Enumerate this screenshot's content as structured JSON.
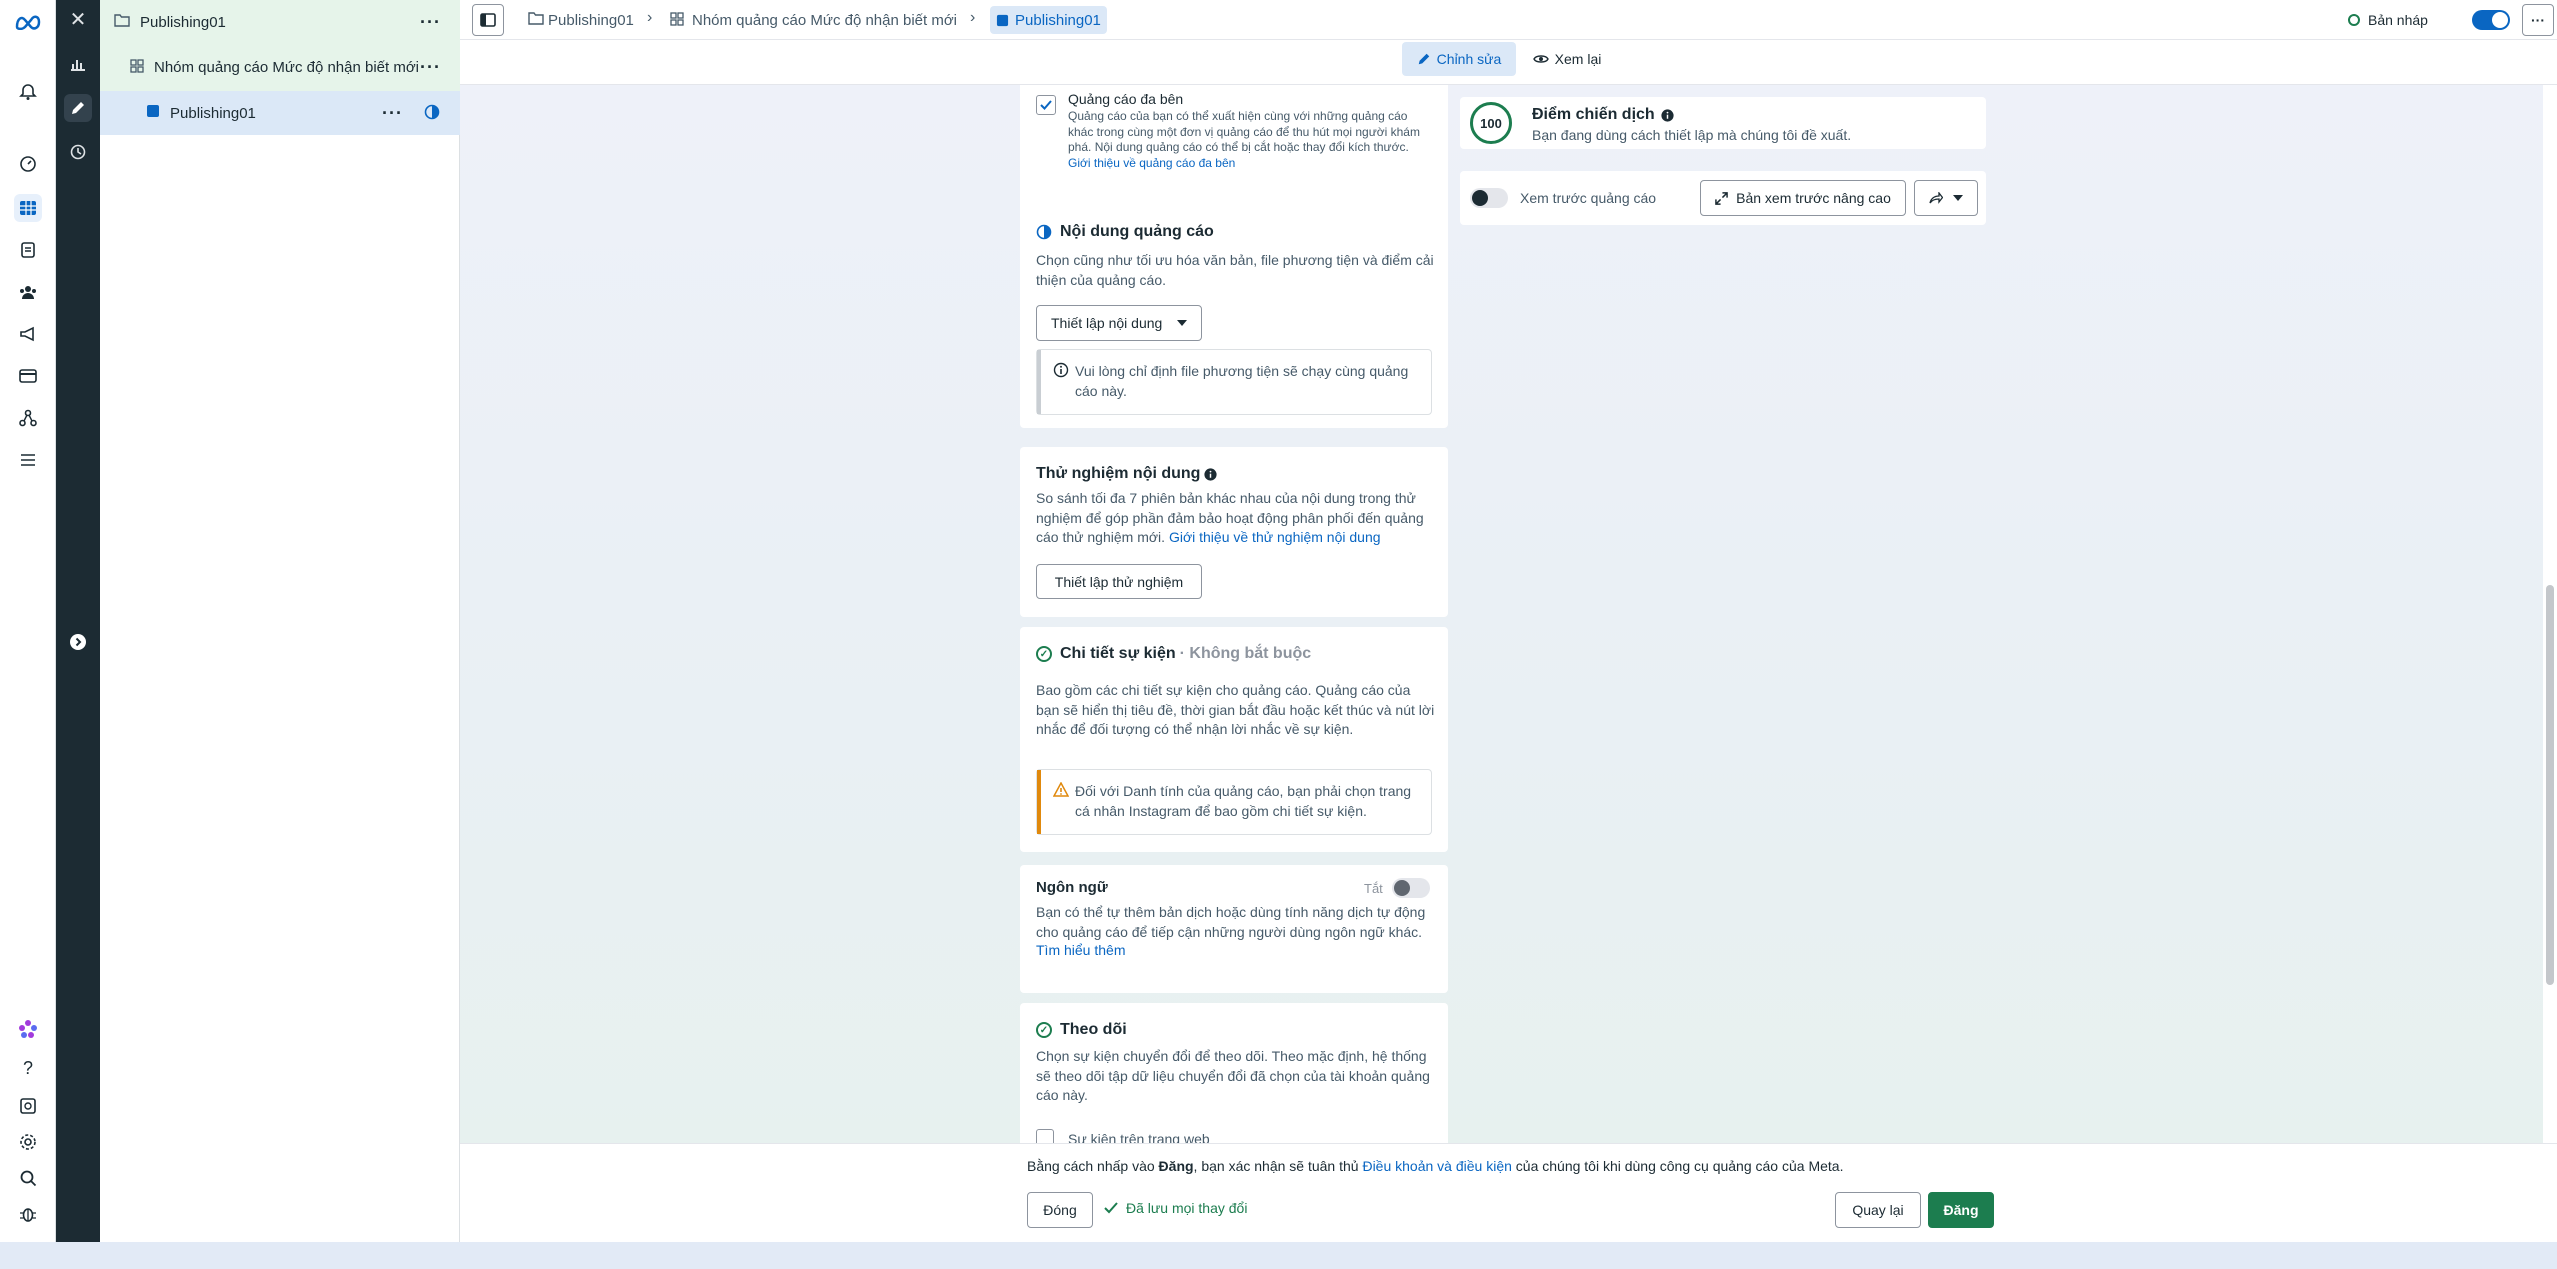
{
  "tree": {
    "campaign": "Publishing01",
    "adset": "Nhóm quảng cáo Mức độ nhận biết mới",
    "ad": "Publishing01"
  },
  "breadcrumb": {
    "campaign": "Publishing01",
    "adset": "Nhóm quảng cáo Mức độ nhận biết mới",
    "ad": "Publishing01"
  },
  "status": {
    "label": "Bản nháp"
  },
  "modes": {
    "edit": "Chỉnh sửa",
    "review": "Xem lại"
  },
  "multi_advertiser": {
    "title": "Quảng cáo đa bên",
    "desc": "Quảng cáo của bạn có thể xuất hiện cùng với những quảng cáo khác trong cùng một đơn vị quảng cáo để thu hút mọi người khám phá. Nội dung quảng cáo có thể bị cắt hoặc thay đổi kích thước.",
    "link": "Giới thiệu về quảng cáo đa bên"
  },
  "creative": {
    "title": "Nội dung quảng cáo",
    "desc": "Chọn cũng như tối ưu hóa văn bản, file phương tiện và điểm cải thiện của quảng cáo.",
    "dropdown": "Thiết lập nội dung",
    "note": "Vui lòng chỉ định file phương tiện sẽ chạy cùng quảng cáo này."
  },
  "creative_test": {
    "title": "Thử nghiệm nội dung",
    "desc": "So sánh tối đa 7 phiên bản khác nhau của nội dung trong thử nghiệm để góp phần đảm bảo hoạt động phân phối đến quảng cáo thử nghiệm mới.",
    "link": "Giới thiệu về thử nghiệm nội dung",
    "button": "Thiết lập thử nghiệm"
  },
  "event_details": {
    "title": "Chi tiết sự kiện",
    "optional": "· Không bắt buộc",
    "desc": "Bao gồm các chi tiết sự kiện cho quảng cáo. Quảng cáo của bạn sẽ hiển thị tiêu đề, thời gian bắt đầu hoặc kết thúc và nút lời nhắc để đối tượng có thể nhận lời nhắc về sự kiện.",
    "warning": "Đối với Danh tính của quảng cáo, bạn phải chọn trang cá nhân Instagram để bao gồm chi tiết sự kiện."
  },
  "language": {
    "title": "Ngôn ngữ",
    "toggle_label": "Tắt",
    "desc": "Bạn có thể tự thêm bản dịch hoặc dùng tính năng dịch tự động cho quảng cáo để tiếp cận những người dùng ngôn ngữ khác.",
    "link": "Tìm hiểu thêm"
  },
  "tracking": {
    "title": "Theo dõi",
    "desc": "Chọn sự kiện chuyển đổi để theo dõi. Theo mặc định, hệ thống sẽ theo dõi tập dữ liệu chuyển đổi đã chọn của tài khoản quảng cáo này.",
    "option": "Sự kiện trên trang web"
  },
  "score": {
    "value": "100",
    "title": "Điểm chiến dịch",
    "desc": "Bạn đang dùng cách thiết lập mà chúng tôi đề xuất."
  },
  "preview": {
    "toggle_label": "Xem trước quảng cáo",
    "advanced": "Bản xem trước nâng cao"
  },
  "footer": {
    "terms_prefix": "Bằng cách nhấp vào ",
    "terms_bold": "Đăng",
    "terms_mid": ", bạn xác nhận sẽ tuân thủ ",
    "terms_link": "Điều khoản và điều kiện",
    "terms_suffix": " của chúng tôi khi dùng công cụ quảng cáo của Meta.",
    "close": "Đóng",
    "saved": "Đã lưu mọi thay đổi",
    "back": "Quay lại",
    "publish": "Đăng"
  },
  "colors": {
    "accent": "#0a66c2",
    "publish": "#1c7d4f",
    "sidebar_dark": "#1c2b33"
  },
  "icons": {
    "rail": [
      "meta-logo",
      "notifications-bell-icon",
      "edit-pencil-icon",
      "dashboard-icon",
      "table-grid-icon",
      "document-icon",
      "audience-icon",
      "campaigns-megaphone-icon",
      "billing-card-icon",
      "events-manager-icon",
      "menu-icon",
      "flower-icon",
      "help-icon",
      "reports-icon",
      "settings-icon",
      "search-icon",
      "bug-icon"
    ]
  }
}
